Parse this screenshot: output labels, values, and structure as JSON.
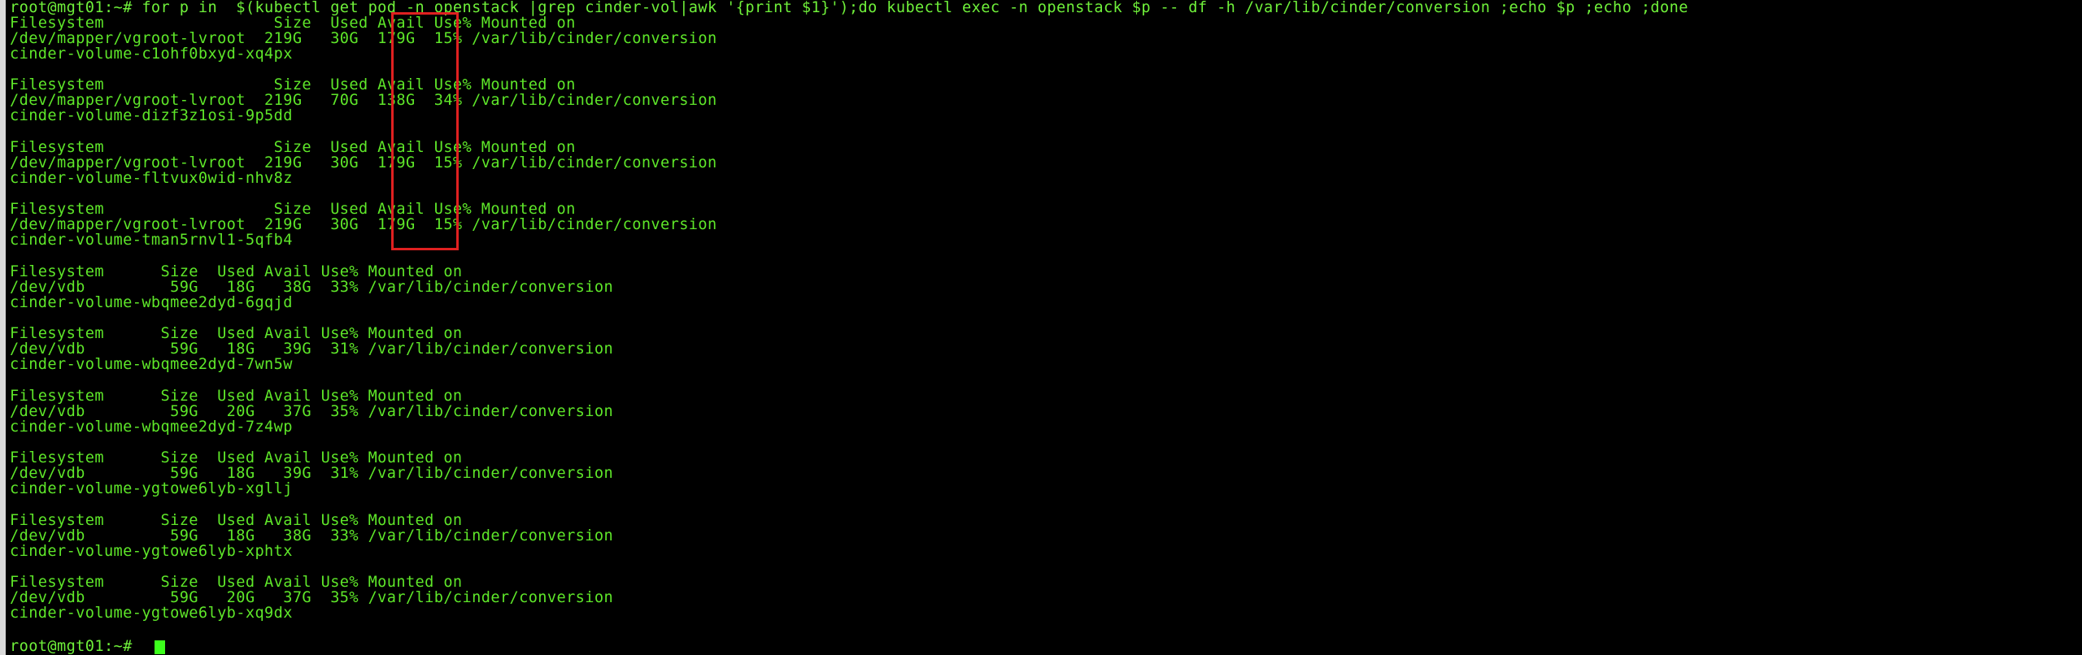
{
  "terminal": {
    "command_line": "root@mgt01:~# for p in  $(kubectl get pod -n openstack |grep cinder-vol|awk '{print $1}');do kubectl exec -n openstack $p -- df -h /var/lib/cinder/conversion ;echo $p ;echo ;done",
    "lines": [
      "Filesystem                  Size  Used Avail Use% Mounted on",
      "/dev/mapper/vgroot-lvroot  219G   30G  179G  15% /var/lib/cinder/conversion",
      "cinder-volume-c1ohf0bxyd-xq4px",
      "",
      "Filesystem                  Size  Used Avail Use% Mounted on",
      "/dev/mapper/vgroot-lvroot  219G   70G  138G  34% /var/lib/cinder/conversion",
      "cinder-volume-dizf3z1osi-9p5dd",
      "",
      "Filesystem                  Size  Used Avail Use% Mounted on",
      "/dev/mapper/vgroot-lvroot  219G   30G  179G  15% /var/lib/cinder/conversion",
      "cinder-volume-fltvux0wid-nhv8z",
      "",
      "Filesystem                  Size  Used Avail Use% Mounted on",
      "/dev/mapper/vgroot-lvroot  219G   30G  179G  15% /var/lib/cinder/conversion",
      "cinder-volume-tman5rnvl1-5qfb4",
      "",
      "Filesystem      Size  Used Avail Use% Mounted on",
      "/dev/vdb         59G   18G   38G  33% /var/lib/cinder/conversion",
      "cinder-volume-wbqmee2dyd-6gqjd",
      "",
      "Filesystem      Size  Used Avail Use% Mounted on",
      "/dev/vdb         59G   18G   39G  31% /var/lib/cinder/conversion",
      "cinder-volume-wbqmee2dyd-7wn5w",
      "",
      "Filesystem      Size  Used Avail Use% Mounted on",
      "/dev/vdb         59G   20G   37G  35% /var/lib/cinder/conversion",
      "cinder-volume-wbqmee2dyd-7z4wp",
      "",
      "Filesystem      Size  Used Avail Use% Mounted on",
      "/dev/vdb         59G   18G   39G  31% /var/lib/cinder/conversion",
      "cinder-volume-ygtowe6lyb-xgllj",
      "",
      "Filesystem      Size  Used Avail Use% Mounted on",
      "/dev/vdb         59G   18G   38G  33% /var/lib/cinder/conversion",
      "cinder-volume-ygtowe6lyb-xphtx",
      "",
      "Filesystem      Size  Used Avail Use% Mounted on",
      "/dev/vdb         59G   20G   37G  35% /var/lib/cinder/conversion",
      "cinder-volume-ygtowe6lyb-xq9dx",
      ""
    ],
    "final_prompt": "root@mgt01:~# "
  },
  "colors": {
    "background": "#000000",
    "text": "#5ee629",
    "cursor": "#3cff1c",
    "highlight_border": "#e02020"
  }
}
